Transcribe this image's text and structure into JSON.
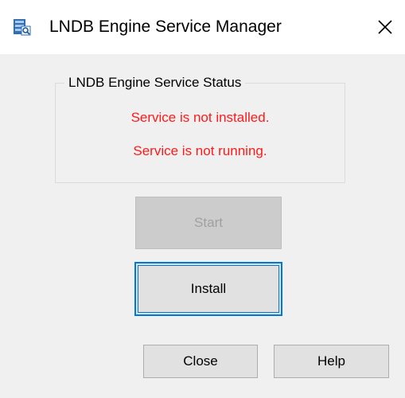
{
  "window": {
    "title": "LNDB Engine Service Manager",
    "close_glyph": "✕",
    "icon": "lndb-app-icon"
  },
  "status_group": {
    "legend": "LNDB Engine Service Status",
    "install_status": "Service is not installed.",
    "run_status": "Service is not running.",
    "status_color": "#ff1a1a"
  },
  "buttons": {
    "start_label": "Start",
    "start_enabled": false,
    "install_label": "Install",
    "close_label": "Close",
    "help_label": "Help"
  },
  "colors": {
    "focus_border": "#0078d7",
    "dialog_bg": "#f0f0f0"
  }
}
